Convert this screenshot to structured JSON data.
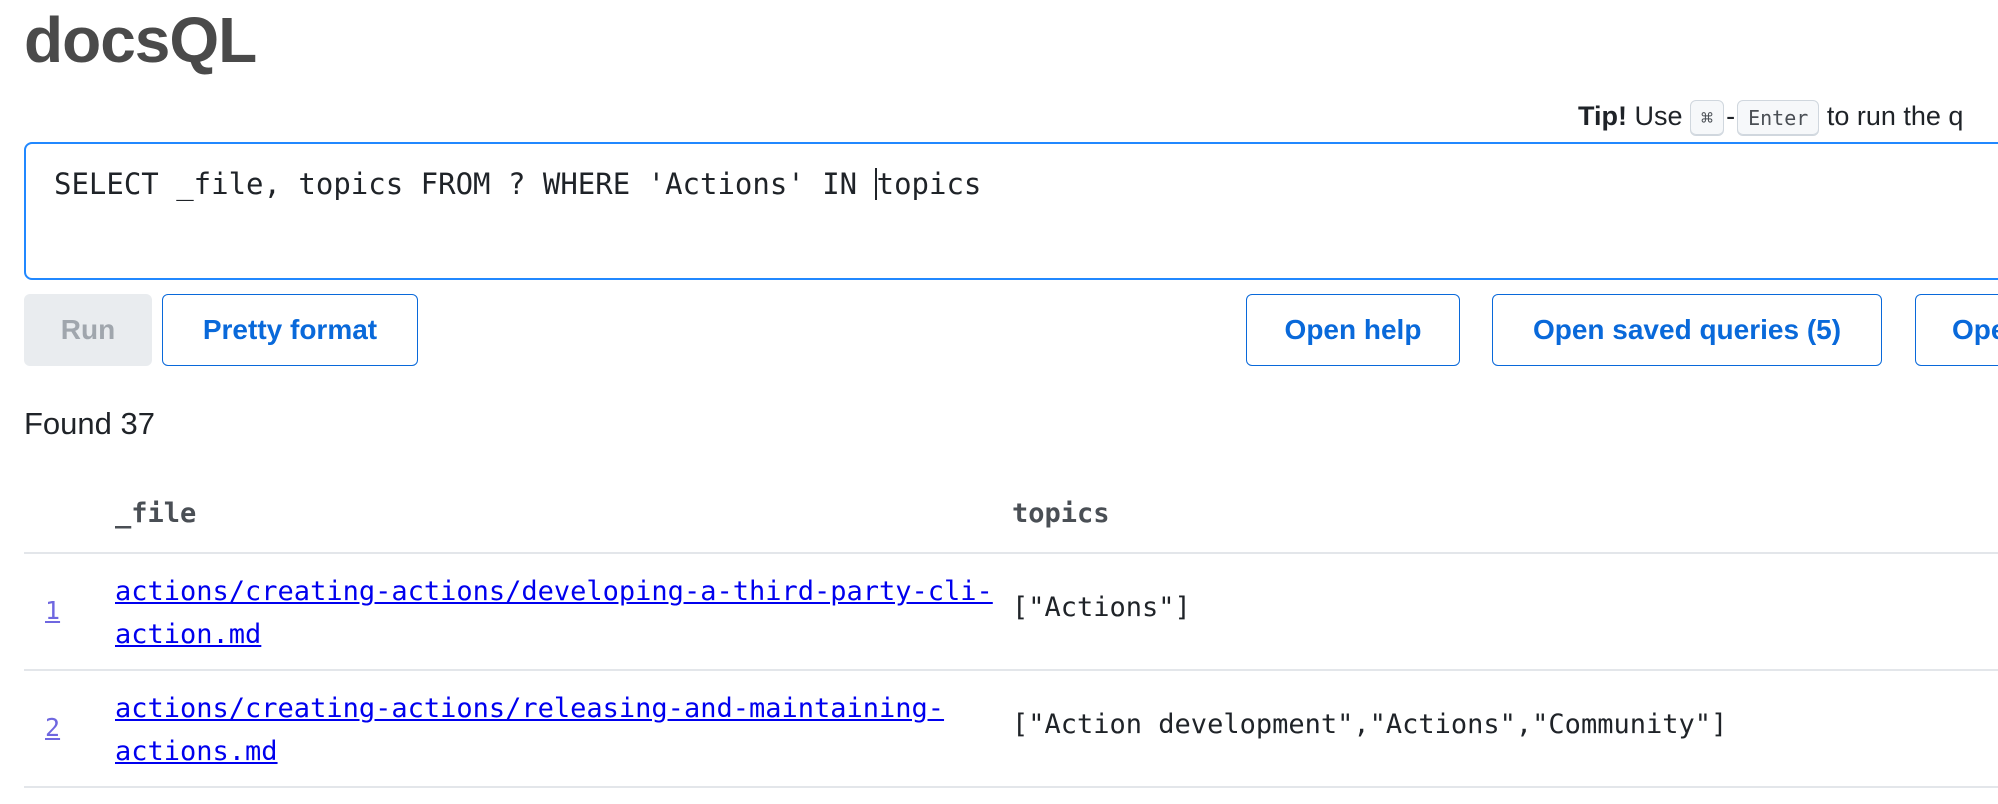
{
  "app": {
    "title": "docsQL"
  },
  "tip": {
    "bold": "Tip!",
    "use": "Use",
    "key1": "⌘",
    "sep": "-",
    "key2": "Enter",
    "rest": "to run the q"
  },
  "editor": {
    "query_before_caret": "SELECT _file, topics FROM ? WHERE 'Actions' IN ",
    "query_after_caret": "topics"
  },
  "toolbar": {
    "run_label": "Run",
    "pretty_label": "Pretty format",
    "help_label": "Open help",
    "saved_label": "Open saved queries (5)",
    "other_label": "Ope"
  },
  "results": {
    "found_text": "Found 37",
    "columns": [
      "_file",
      "topics"
    ],
    "rows": [
      {
        "num": "1",
        "file_line1": "actions/creating-actions/developing-a-third-party-cli-",
        "file_line2": "action.md",
        "topics": "[\"Actions\"]"
      },
      {
        "num": "2",
        "file_line1": "actions/creating-actions/releasing-and-maintaining-",
        "file_line2": "actions.md",
        "topics": "[\"Action development\",\"Actions\",\"Community\"]"
      }
    ]
  },
  "colors": {
    "accent": "#0969da",
    "editor_border": "#2188ff",
    "link": "#0000ee",
    "rownum_link": "#6f67e0",
    "disabled_bg": "#e9ecef"
  }
}
